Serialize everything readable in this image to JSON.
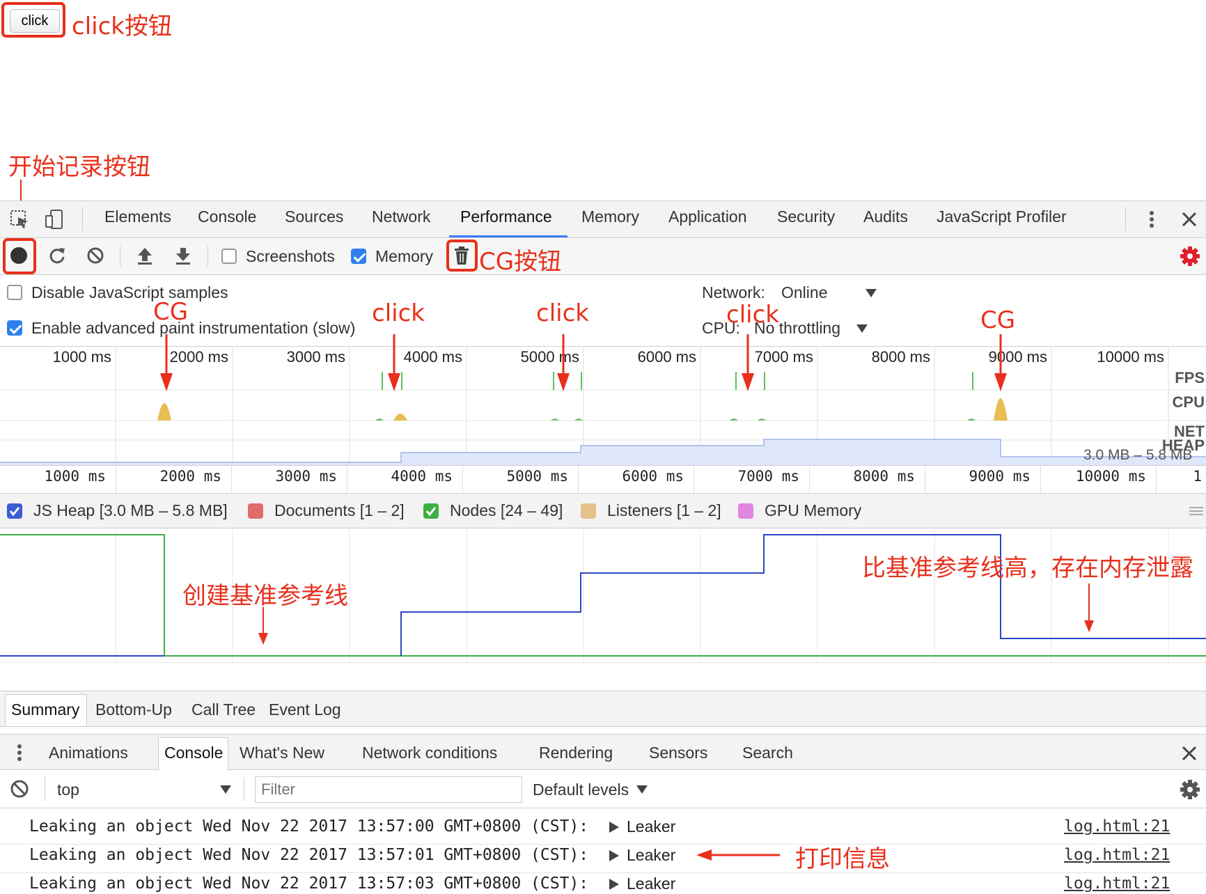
{
  "page": {
    "click_button_label": "click"
  },
  "annotations": {
    "click_button": "click按钮",
    "record_button": "开始记录按钮",
    "cg_button": "CG按钮",
    "timeline_marks": [
      "CG",
      "click",
      "click",
      "click",
      "CG"
    ],
    "baseline": "创建基准参考线",
    "leak_note": "比基准参考线高，存在内存泄露",
    "log_note": "打印信息"
  },
  "devtools": {
    "tabs": [
      "Elements",
      "Console",
      "Sources",
      "Network",
      "Performance",
      "Memory",
      "Application",
      "Security",
      "Audits",
      "JavaScript Profiler"
    ],
    "active_tab": "Performance",
    "icons": [
      "inspect-icon",
      "device-toolbar-icon",
      "more-icon",
      "close-icon"
    ]
  },
  "perf_toolbar": {
    "screenshots_label": "Screenshots",
    "screenshots_checked": false,
    "memory_label": "Memory",
    "memory_checked": true
  },
  "perf_settings": {
    "disable_js_samples": "Disable JavaScript samples",
    "disable_js_samples_checked": false,
    "enable_paint": "Enable advanced paint instrumentation (slow)",
    "enable_paint_checked": true,
    "network_label": "Network:",
    "network_value": "Online",
    "cpu_label": "CPU:",
    "cpu_value": "No throttling"
  },
  "overview": {
    "ticks": [
      "1000 ms",
      "2000 ms",
      "3000 ms",
      "4000 ms",
      "5000 ms",
      "6000 ms",
      "7000 ms",
      "8000 ms",
      "9000 ms",
      "10000 ms"
    ],
    "track_labels": [
      "FPS",
      "CPU",
      "NET",
      "HEAP"
    ],
    "heap_range": "3.0 MB – 5.8 MB"
  },
  "ruler": {
    "ticks": [
      "1000 ms",
      "2000 ms",
      "3000 ms",
      "4000 ms",
      "5000 ms",
      "6000 ms",
      "7000 ms",
      "8000 ms",
      "9000 ms",
      "10000 ms",
      "1"
    ]
  },
  "legend": [
    {
      "label": "JS Heap [3.0 MB – 5.8 MB]",
      "color": "#3b5fd1",
      "checked": true
    },
    {
      "label": "Documents [1 – 2]",
      "color": "#e06c6c",
      "checked": false
    },
    {
      "label": "Nodes [24 – 49]",
      "color": "#3cb043",
      "checked": true
    },
    {
      "label": "Listeners [1 – 2]",
      "color": "#e5c08a",
      "checked": false
    },
    {
      "label": "GPU Memory",
      "color": "#e085e0",
      "checked": false
    }
  ],
  "bottom_tabs": [
    "Summary",
    "Bottom-Up",
    "Call Tree",
    "Event Log"
  ],
  "drawer": {
    "tabs": [
      "Animations",
      "Console",
      "What's New",
      "Network conditions",
      "Rendering",
      "Sensors",
      "Search"
    ],
    "active_tab": "Console",
    "context": "top",
    "filter_placeholder": "Filter",
    "levels": "Default levels"
  },
  "console_logs": [
    {
      "message": "Leaking an object Wed Nov 22 2017 13:57:00 GMT+0800 (CST):",
      "object": "Leaker",
      "source": "log.html:21"
    },
    {
      "message": "Leaking an object Wed Nov 22 2017 13:57:01 GMT+0800 (CST):",
      "object": "Leaker",
      "source": "log.html:21"
    },
    {
      "message": "Leaking an object Wed Nov 22 2017 13:57:03 GMT+0800 (CST):",
      "object": "Leaker",
      "source": "log.html:21"
    }
  ]
}
